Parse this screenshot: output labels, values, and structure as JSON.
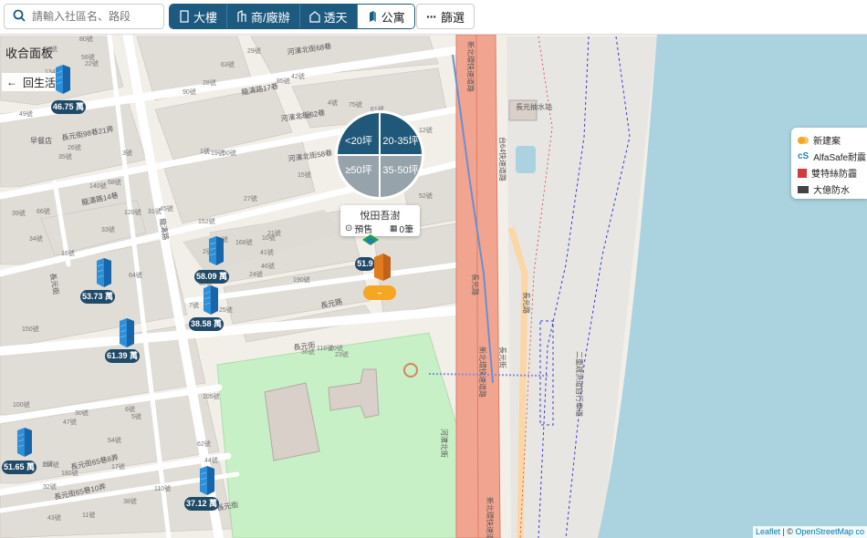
{
  "search": {
    "placeholder": "請輸入社區名、路段"
  },
  "property_types": [
    {
      "label": "大樓",
      "icon": "building-icon",
      "active": true
    },
    {
      "label": "商/廠辦",
      "icon": "office-icon",
      "active": true
    },
    {
      "label": "透天",
      "icon": "house-icon",
      "active": true
    },
    {
      "label": "公寓",
      "icon": "apartment-icon",
      "active": false
    }
  ],
  "filter_label": "篩選",
  "panel": {
    "collapse_label": "收合面板",
    "back_label": "回生活圈"
  },
  "size_menu": {
    "options": [
      "<20坪",
      "20-35坪",
      "≥50坪",
      "35-50坪"
    ]
  },
  "popup": {
    "name": "悅田吾澍",
    "status": "預售",
    "count": "0筆"
  },
  "price_markers": [
    "46.75 萬",
    "58.09 萬",
    "53.73 萬",
    "38.58 萬",
    "61.39 萬",
    "51.65 萬",
    "37.12 萬",
    "51.9"
  ],
  "orange_marker": "–",
  "legend": [
    {
      "label": "新建案",
      "icon": "new-project-icon"
    },
    {
      "label": "AlfaSafe耐震",
      "icon": "alfasafe-icon"
    },
    {
      "label": "雙特絲防霾",
      "icon": "smog-icon"
    },
    {
      "label": "大億防水",
      "icon": "waterproof-icon"
    }
  ],
  "attribution": {
    "leaflet": "Leaflet",
    "sep": " | © ",
    "osm": "OpenStreetMap co"
  },
  "streets": {
    "s1": "河濱北街68巷",
    "s2": "龍濤路17巷",
    "s3": "河濱北街62巷",
    "s4": "河濱北街58巷",
    "s5": "長元街98巷21弄",
    "s6": "龍濤路14巷",
    "s7": "長元街",
    "s8": "長元街",
    "s9": "長元街65巷8弄",
    "s10": "長元街65巷10弄",
    "s11": "龍濤路",
    "s12": "長元路",
    "s13": "長元街",
    "s14": "新北環快速道路",
    "s15": "台64快速道路",
    "s16": "長元路",
    "s17": "長元街",
    "s18": "長元路",
    "s19": "二重疏洪道自行車道",
    "s20": "新北環快速道路",
    "s21": "新北環快速道路",
    "s22": "河濱北街",
    "poi_station": "長元抽水站",
    "poi_food": "早餐店",
    "poi_cafe": "咖啡",
    "num_list": [
      "25號",
      "35號",
      "40號",
      "8號",
      "10號",
      "5號",
      "42號",
      "50號",
      "13號",
      "24號",
      "22號",
      "18號",
      "16號",
      "12號",
      "7號",
      "15號",
      "11號",
      "1號",
      "27號",
      "30號",
      "45號",
      "32號",
      "17號",
      "19號",
      "21號",
      "23號",
      "26號",
      "28號",
      "34號",
      "36號",
      "52號",
      "60號",
      "62號",
      "2號",
      "3號",
      "4號",
      "6號",
      "9號",
      "14號",
      "20號",
      "29號",
      "31號",
      "33號",
      "37號",
      "38號",
      "39號",
      "41號",
      "43號",
      "44號",
      "46號",
      "47號",
      "48號",
      "49號",
      "51號",
      "53號",
      "54號",
      "56號",
      "58號",
      "59號",
      "61號",
      "63號",
      "64號",
      "66號",
      "68號",
      "75號",
      "80號",
      "85號",
      "90號",
      "95號",
      "100號",
      "105號",
      "110號",
      "116號",
      "120號",
      "124號",
      "134號",
      "140號",
      "150號",
      "152號",
      "160號",
      "168號",
      "180號",
      "190號",
      "200號"
    ]
  }
}
